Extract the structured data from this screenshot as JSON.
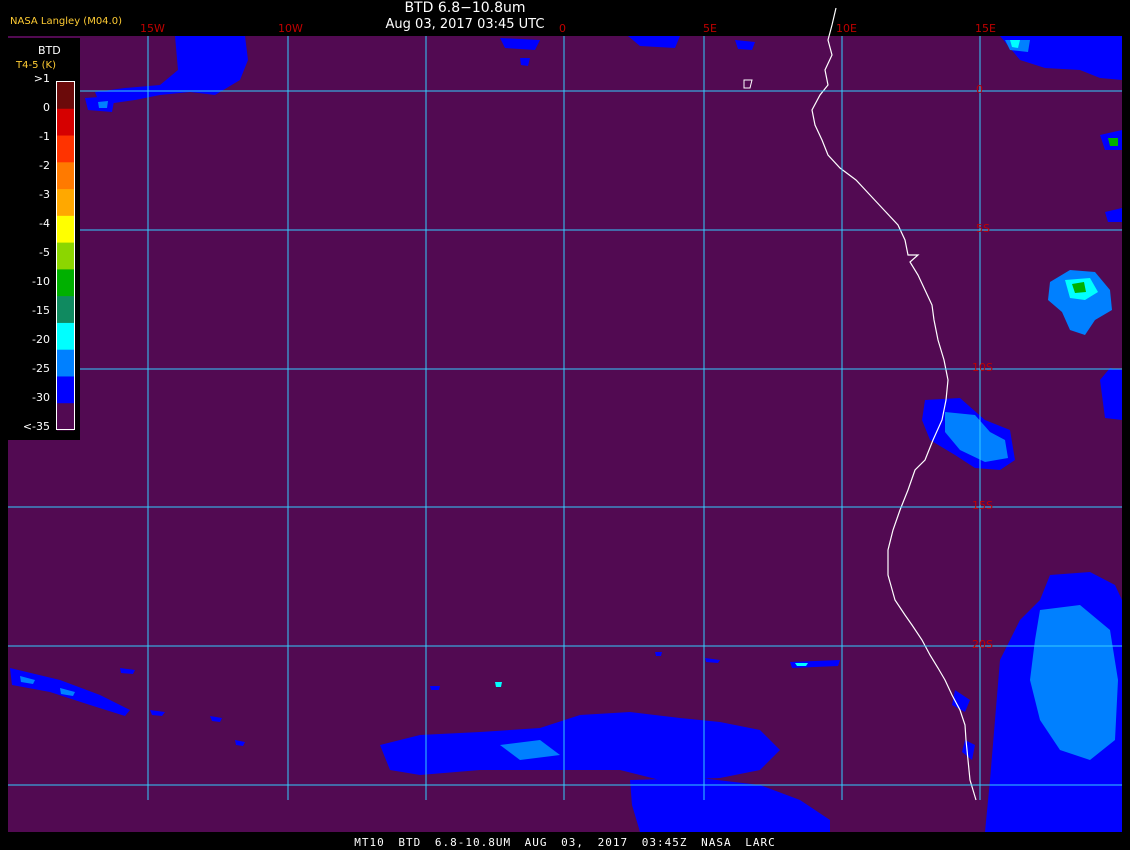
{
  "header": {
    "title": "BTD 6.8−10.8um",
    "timestamp": "Aug 03, 2017 03:45 UTC",
    "organization": "NASA Langley (M04.0)"
  },
  "footer": {
    "text": "MT10 BTD 6.8-10.8UM AUG 03, 2017 03:45Z NASA LARC"
  },
  "legend": {
    "title": "BTD",
    "units": "T4-5 (K)",
    "labels": [
      ">1",
      "0",
      "-1",
      "-2",
      "-3",
      "-4",
      "-5",
      "-10",
      "-15",
      "-20",
      "-25",
      "-30",
      "<-35"
    ],
    "colors": [
      "#6b0a0a",
      "#d60000",
      "#ff3300",
      "#ff7a00",
      "#ffa800",
      "#ffff00",
      "#8cd600",
      "#00b000",
      "#108a60",
      "#00ffff",
      "#0080ff",
      "#0000ff",
      "#520a52"
    ]
  },
  "map": {
    "background_color": "#520a52",
    "grid_color": "#33ccff",
    "coast_color": "#ffffff",
    "cloud_colors": {
      "low": "#0000ff",
      "mid": "#0080ff",
      "cyan": "#00ffff",
      "green": "#00b000"
    },
    "longitude_labels": [
      "15W",
      "10W",
      "0",
      "5E",
      "10E",
      "15E"
    ],
    "latitude_labels": [
      "0",
      "5S",
      "10S",
      "15S",
      "20S"
    ],
    "label_color": "#c00000"
  }
}
